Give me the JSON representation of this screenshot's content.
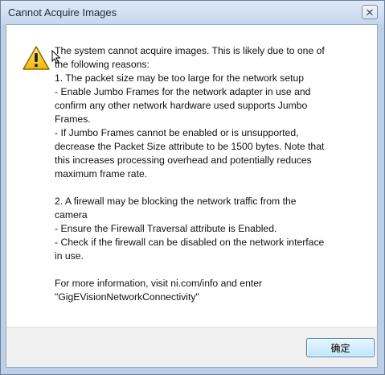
{
  "window": {
    "title": "Cannot Acquire Images",
    "close_glyph": "✕"
  },
  "icon": "warning-icon",
  "message_lines": [
    "The system cannot acquire images. This is likely due to one of",
    "the following reasons:",
    "1. The packet size may be too large for the network setup",
    "- Enable Jumbo Frames for the network adapter in use and",
    "confirm any other network hardware used supports Jumbo",
    "Frames.",
    "- If Jumbo Frames cannot be enabled or is unsupported,",
    "decrease the Packet Size attribute to be 1500 bytes. Note that",
    "this increases processing overhead and potentially reduces",
    "maximum frame rate.",
    "",
    "2. A firewall may be blocking the network traffic from the",
    "camera",
    "- Ensure the Firewall Traversal attribute is Enabled.",
    "- Check if the firewall can be disabled on the network interface",
    "in use.",
    "",
    "For more information, visit ni.com/info and enter",
    "\"GigEVisionNetworkConnectivity\""
  ],
  "buttons": {
    "ok_label": "确定"
  },
  "colors": {
    "titlebar": "#c4d6ed",
    "button_border": "#3c7fb1",
    "warning_fill": "#f5c518"
  }
}
